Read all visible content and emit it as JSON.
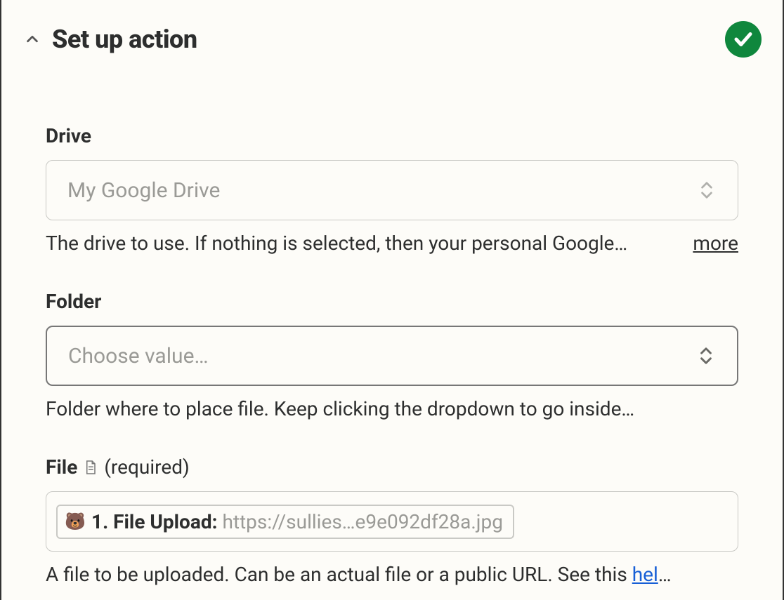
{
  "header": {
    "title": "Set up action"
  },
  "fields": {
    "drive": {
      "label": "Drive",
      "value": "My Google Drive",
      "helper": "The drive to use. If nothing is selected, then your personal Google…",
      "more": "more"
    },
    "folder": {
      "label": "Folder",
      "placeholder": "Choose value…",
      "helper": "Folder where to place file. Keep clicking the dropdown to go inside…"
    },
    "file": {
      "label": "File",
      "required": "(required)",
      "pill_label": "1. File Upload: ",
      "pill_value": "https://sullies…e9e092df28a.jpg",
      "helper_pre": "A file to be uploaded. Can be an actual file or a public URL. See this ",
      "helper_link": "hel",
      "helper_post": "…"
    }
  }
}
